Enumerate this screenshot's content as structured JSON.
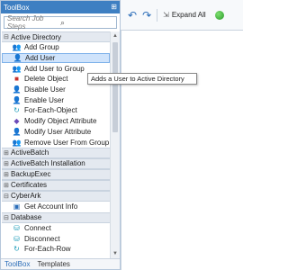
{
  "toolbox": {
    "title": "ToolBox",
    "pin_icon": "pin-icon",
    "search": {
      "placeholder": "Search Job Steps",
      "icon": "search-icon"
    }
  },
  "groups": [
    {
      "label": "Active Directory",
      "expanded": true,
      "items": [
        {
          "label": "Add Group",
          "icon": "group-add-icon"
        },
        {
          "label": "Add User",
          "icon": "user-add-icon",
          "selected": true
        },
        {
          "label": "Add User to Group",
          "icon": "user-to-group-icon"
        },
        {
          "label": "Delete Object",
          "icon": "delete-object-icon"
        },
        {
          "label": "Disable User",
          "icon": "disable-user-icon"
        },
        {
          "label": "Enable User",
          "icon": "enable-user-icon"
        },
        {
          "label": "For-Each-Object",
          "icon": "loop-icon"
        },
        {
          "label": "Modify Object Attribute",
          "icon": "modify-object-icon"
        },
        {
          "label": "Modify User Attribute",
          "icon": "modify-user-icon"
        },
        {
          "label": "Remove User From Group",
          "icon": "remove-user-icon"
        }
      ]
    },
    {
      "label": "ActiveBatch",
      "expanded": false,
      "items": []
    },
    {
      "label": "ActiveBatch Installation",
      "expanded": false,
      "items": []
    },
    {
      "label": "BackupExec",
      "expanded": false,
      "items": []
    },
    {
      "label": "Certificates",
      "expanded": false,
      "items": []
    },
    {
      "label": "CyberArk",
      "expanded": true,
      "items": [
        {
          "label": "Get Account Info",
          "icon": "account-info-icon"
        }
      ]
    },
    {
      "label": "Database",
      "expanded": true,
      "items": [
        {
          "label": "Connect",
          "icon": "connect-icon"
        },
        {
          "label": "Disconnect",
          "icon": "disconnect-icon"
        },
        {
          "label": "For-Each-Row",
          "icon": "loop-icon"
        }
      ]
    }
  ],
  "tabs": [
    {
      "label": "ToolBox",
      "active": true
    },
    {
      "label": "Templates",
      "active": false
    }
  ],
  "toolbar": {
    "undo_icon": "undo-icon",
    "redo_icon": "redo-icon",
    "expand_label": "Expand All"
  },
  "tooltip": {
    "text": "Adds a User to Active Directory"
  },
  "colors": {
    "title_bar": "#3e7fc2",
    "selection": "#cfe3fb",
    "accent": "#2b6db8"
  }
}
